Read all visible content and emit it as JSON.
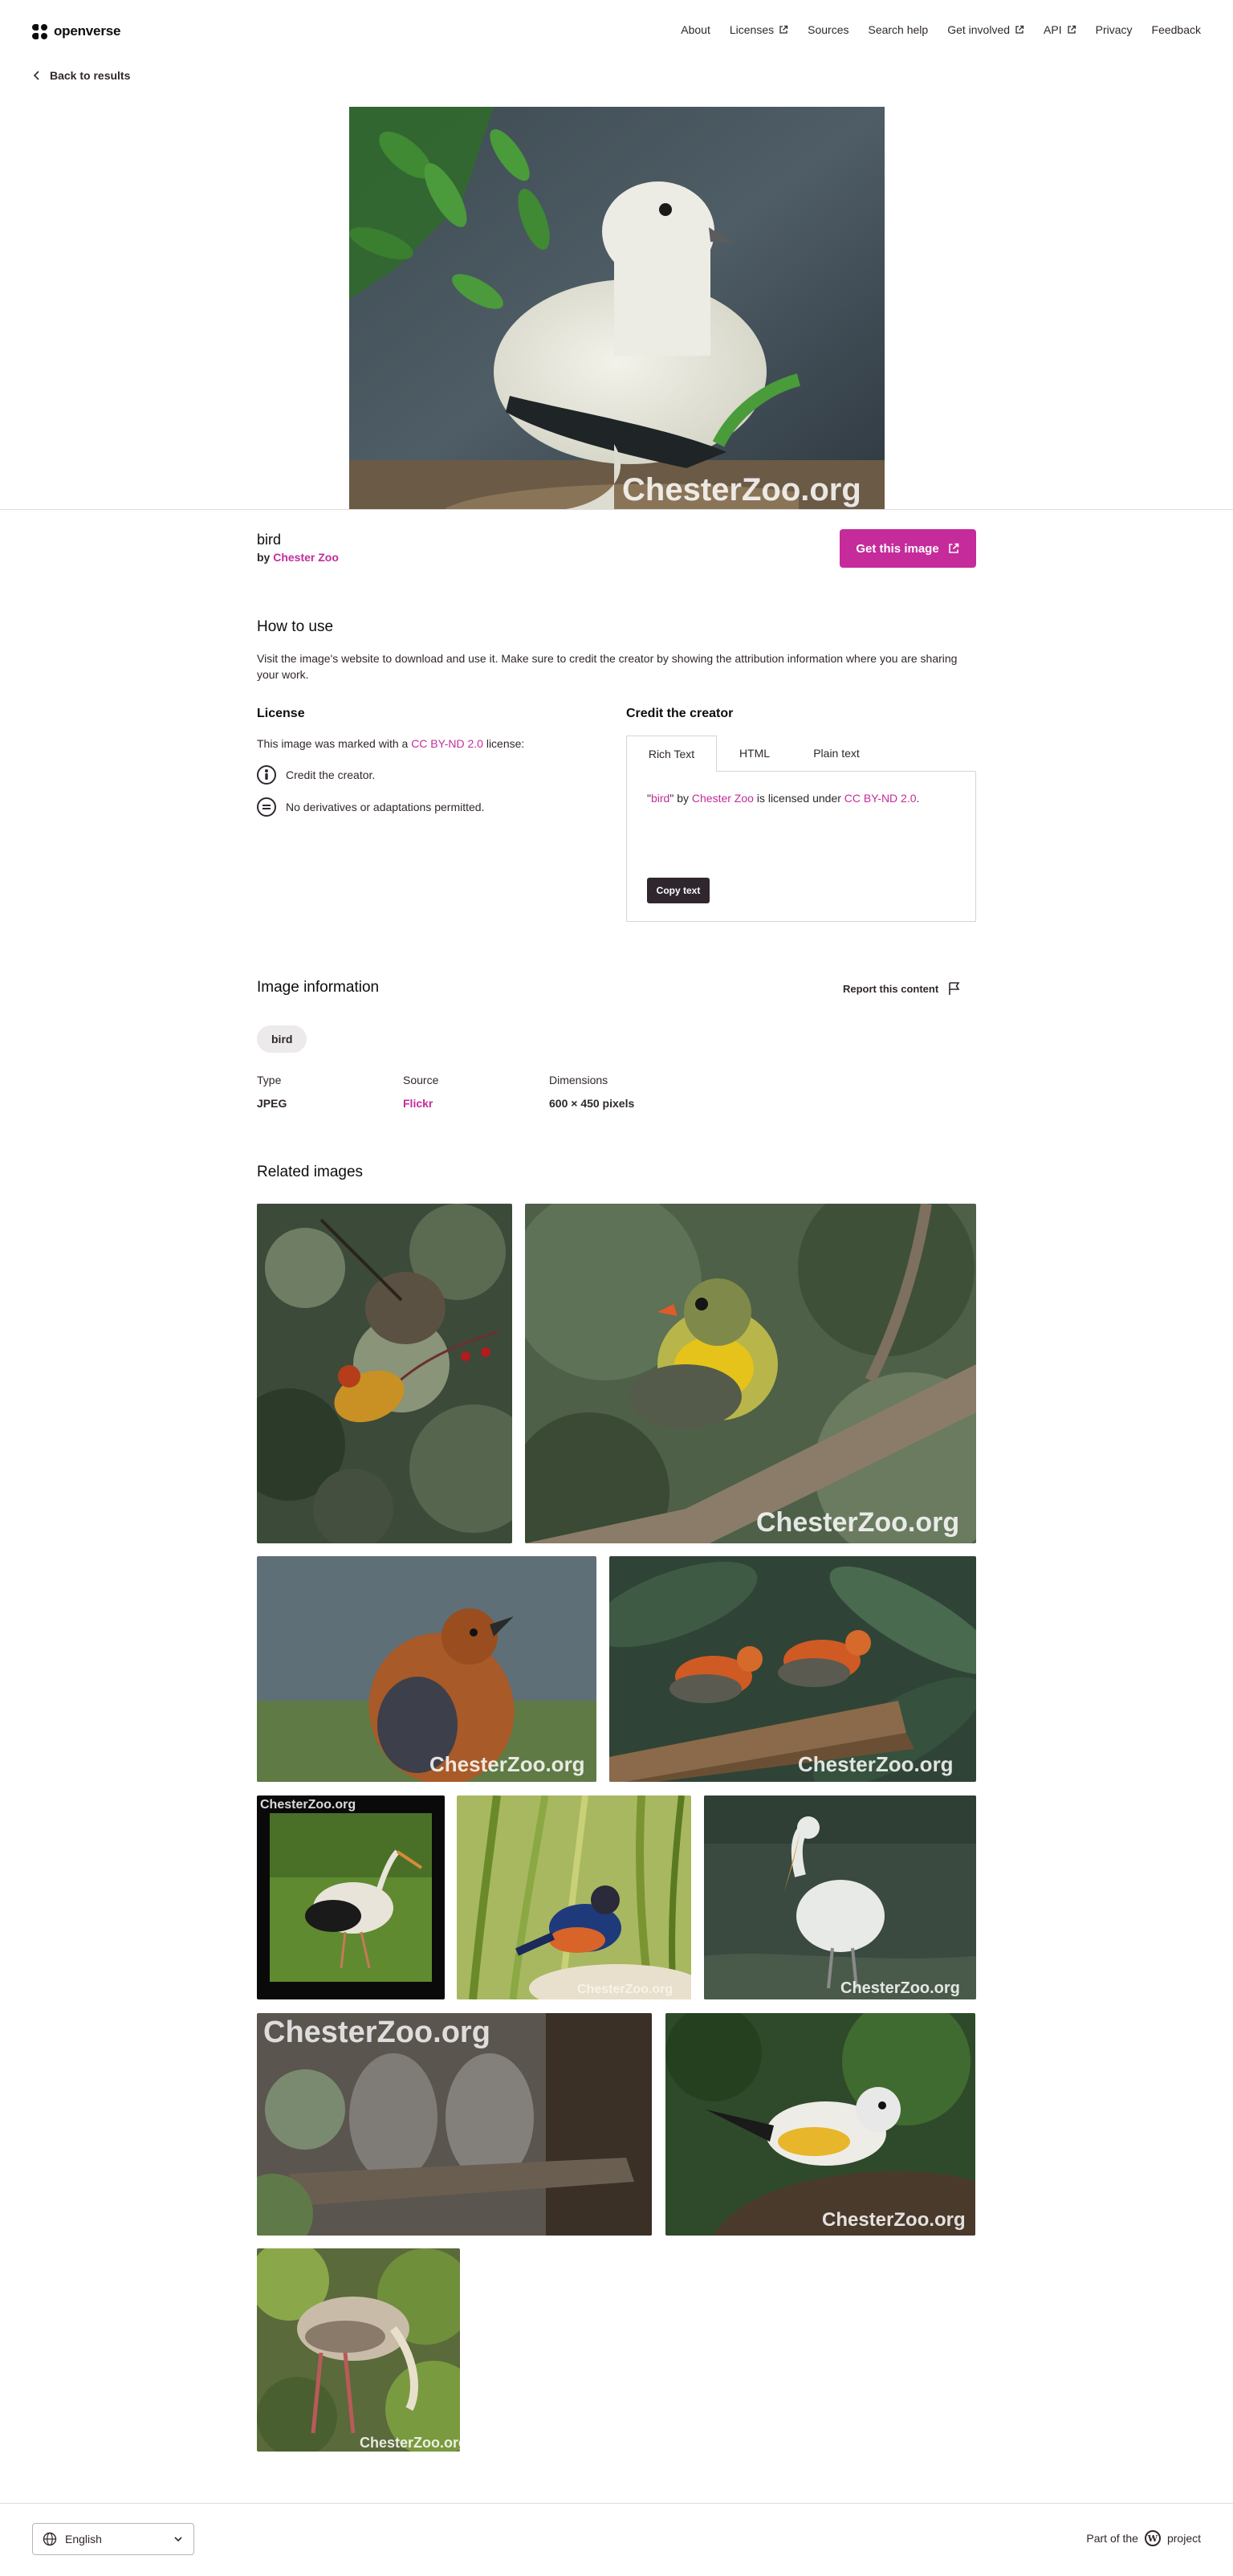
{
  "header": {
    "logo_text": "openverse",
    "nav": [
      {
        "label": "About",
        "external": false
      },
      {
        "label": "Licenses",
        "external": true
      },
      {
        "label": "Sources",
        "external": false
      },
      {
        "label": "Search help",
        "external": false
      },
      {
        "label": "Get involved",
        "external": true
      },
      {
        "label": "API",
        "external": true
      },
      {
        "label": "Privacy",
        "external": false
      },
      {
        "label": "Feedback",
        "external": false
      }
    ]
  },
  "back_link": "Back to results",
  "main_image": {
    "watermark": "ChesterZoo.org"
  },
  "title_bar": {
    "title": "bird",
    "by_prefix": "by",
    "creator": "Chester Zoo",
    "get_button": "Get this image"
  },
  "how_to_use": {
    "heading": "How to use",
    "text": "Visit the image's website to download and use it. Make sure to credit the creator by showing the attribution information where you are sharing your work."
  },
  "license": {
    "heading": "License",
    "text_prefix": "This image was marked with a",
    "license_name": "CC BY-ND 2.0",
    "text_suffix": "license:",
    "items": [
      "Credit the creator.",
      "No derivatives or adaptations permitted."
    ]
  },
  "credit": {
    "heading": "Credit the creator",
    "tabs": [
      "Rich Text",
      "HTML",
      "Plain text"
    ],
    "active_tab": "Rich Text",
    "text_open_quote": "\"",
    "work": "bird",
    "text_close_quote_by": "\" by",
    "creator": "Chester Zoo",
    "licensed_under": "is licensed under",
    "license": "CC BY-ND 2.0",
    "period": ".",
    "copy_button": "Copy text"
  },
  "image_info": {
    "heading": "Image information",
    "report": "Report this content",
    "tags": [
      "bird"
    ],
    "fields": [
      {
        "label": "Type",
        "value": "JPEG"
      },
      {
        "label": "Source",
        "value": "Flickr"
      },
      {
        "label": "Dimensions",
        "value": "600 × 450 pixels"
      }
    ]
  },
  "related": {
    "heading": "Related images",
    "watermark": "ChesterZoo.org"
  },
  "footer": {
    "language": "English",
    "part_of_prefix": "Part of the",
    "part_of_suffix": "project",
    "wp_letter": "W"
  },
  "colors": {
    "brand_pink": "#c52b9b",
    "text": "#30272e",
    "copy_button_bg": "#30272e"
  }
}
